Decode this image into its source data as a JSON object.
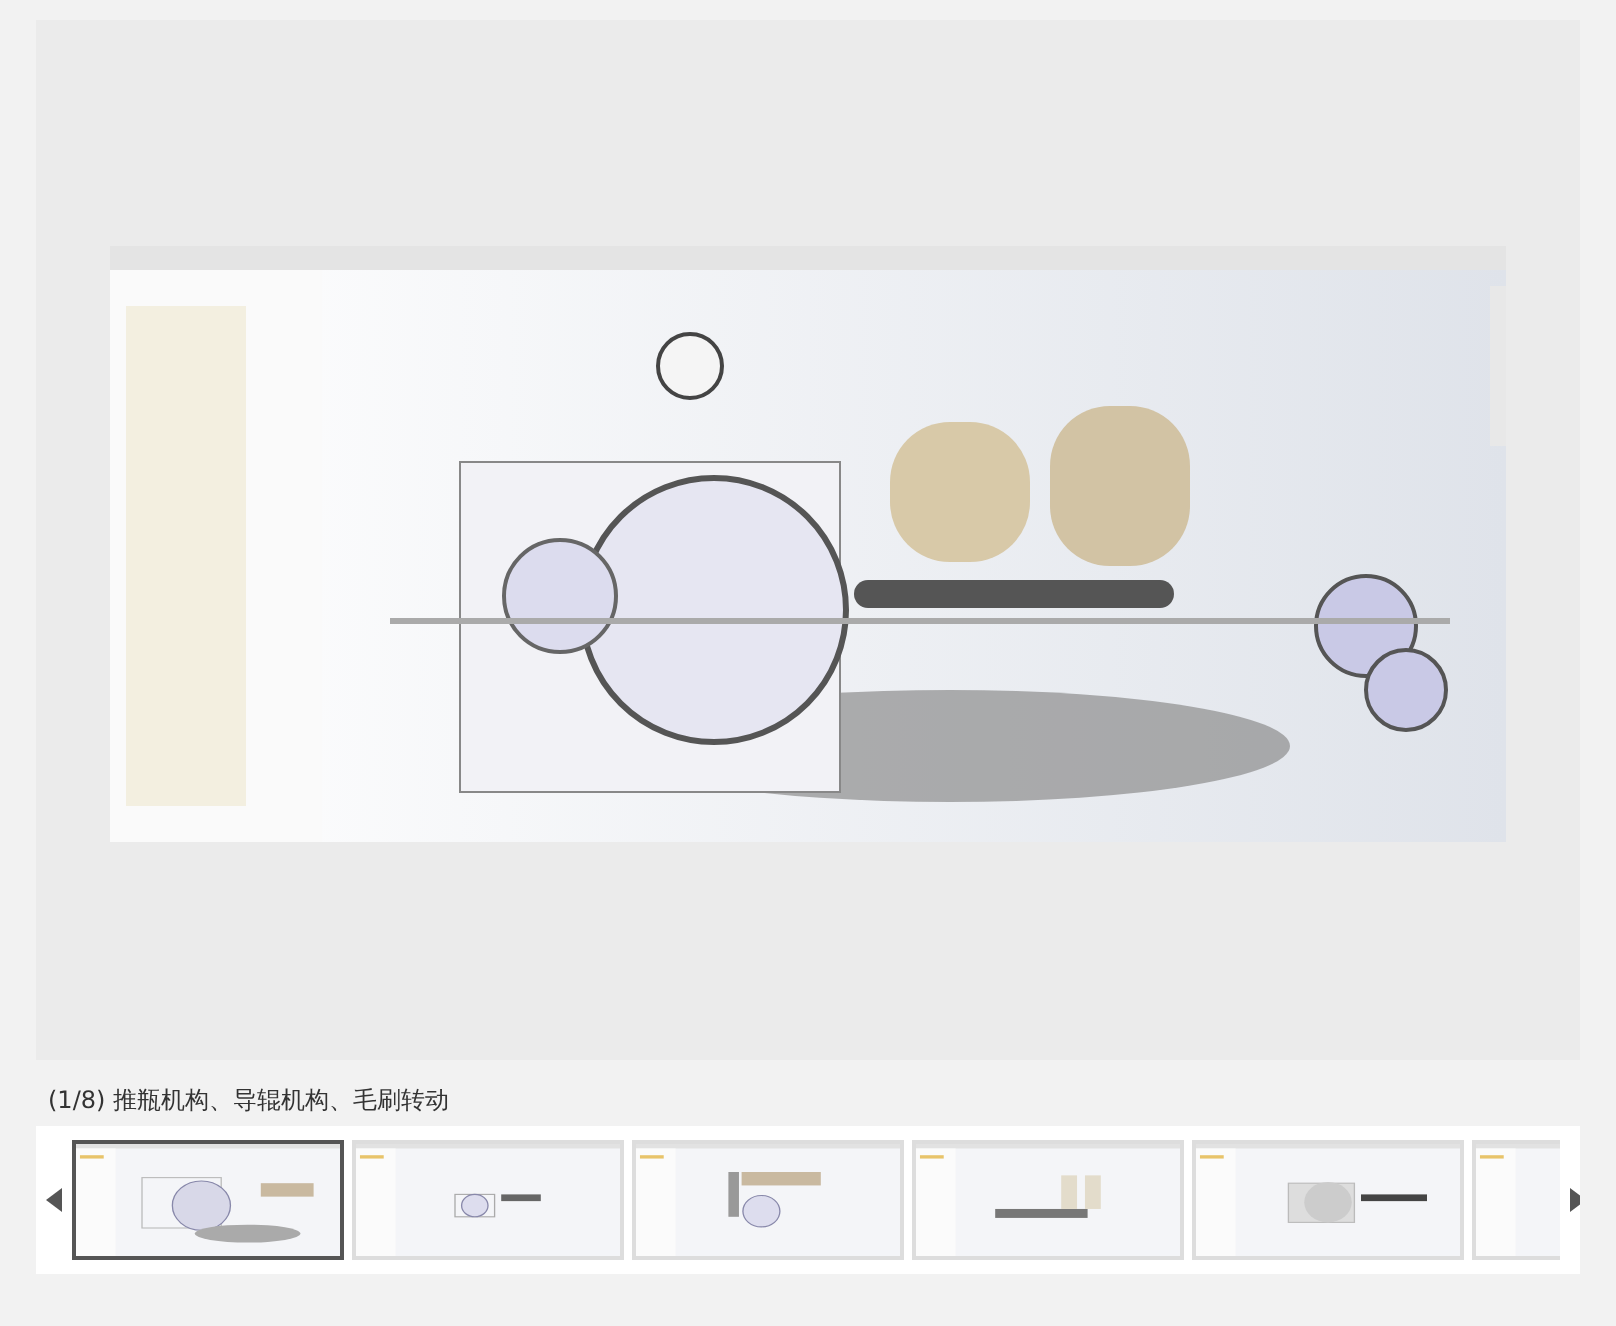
{
  "viewer": {
    "image": {
      "kind": "picture"
    }
  },
  "caption": "(1/8) 推瓶机构、导辊机构、毛刷转动",
  "thumbnails": [
    {
      "selected": true,
      "kind": "picture"
    },
    {
      "selected": false,
      "kind": "picture"
    },
    {
      "selected": false,
      "kind": "picture"
    },
    {
      "selected": false,
      "kind": "picture"
    },
    {
      "selected": false,
      "kind": "picture"
    },
    {
      "selected": false,
      "kind": "picture"
    }
  ]
}
